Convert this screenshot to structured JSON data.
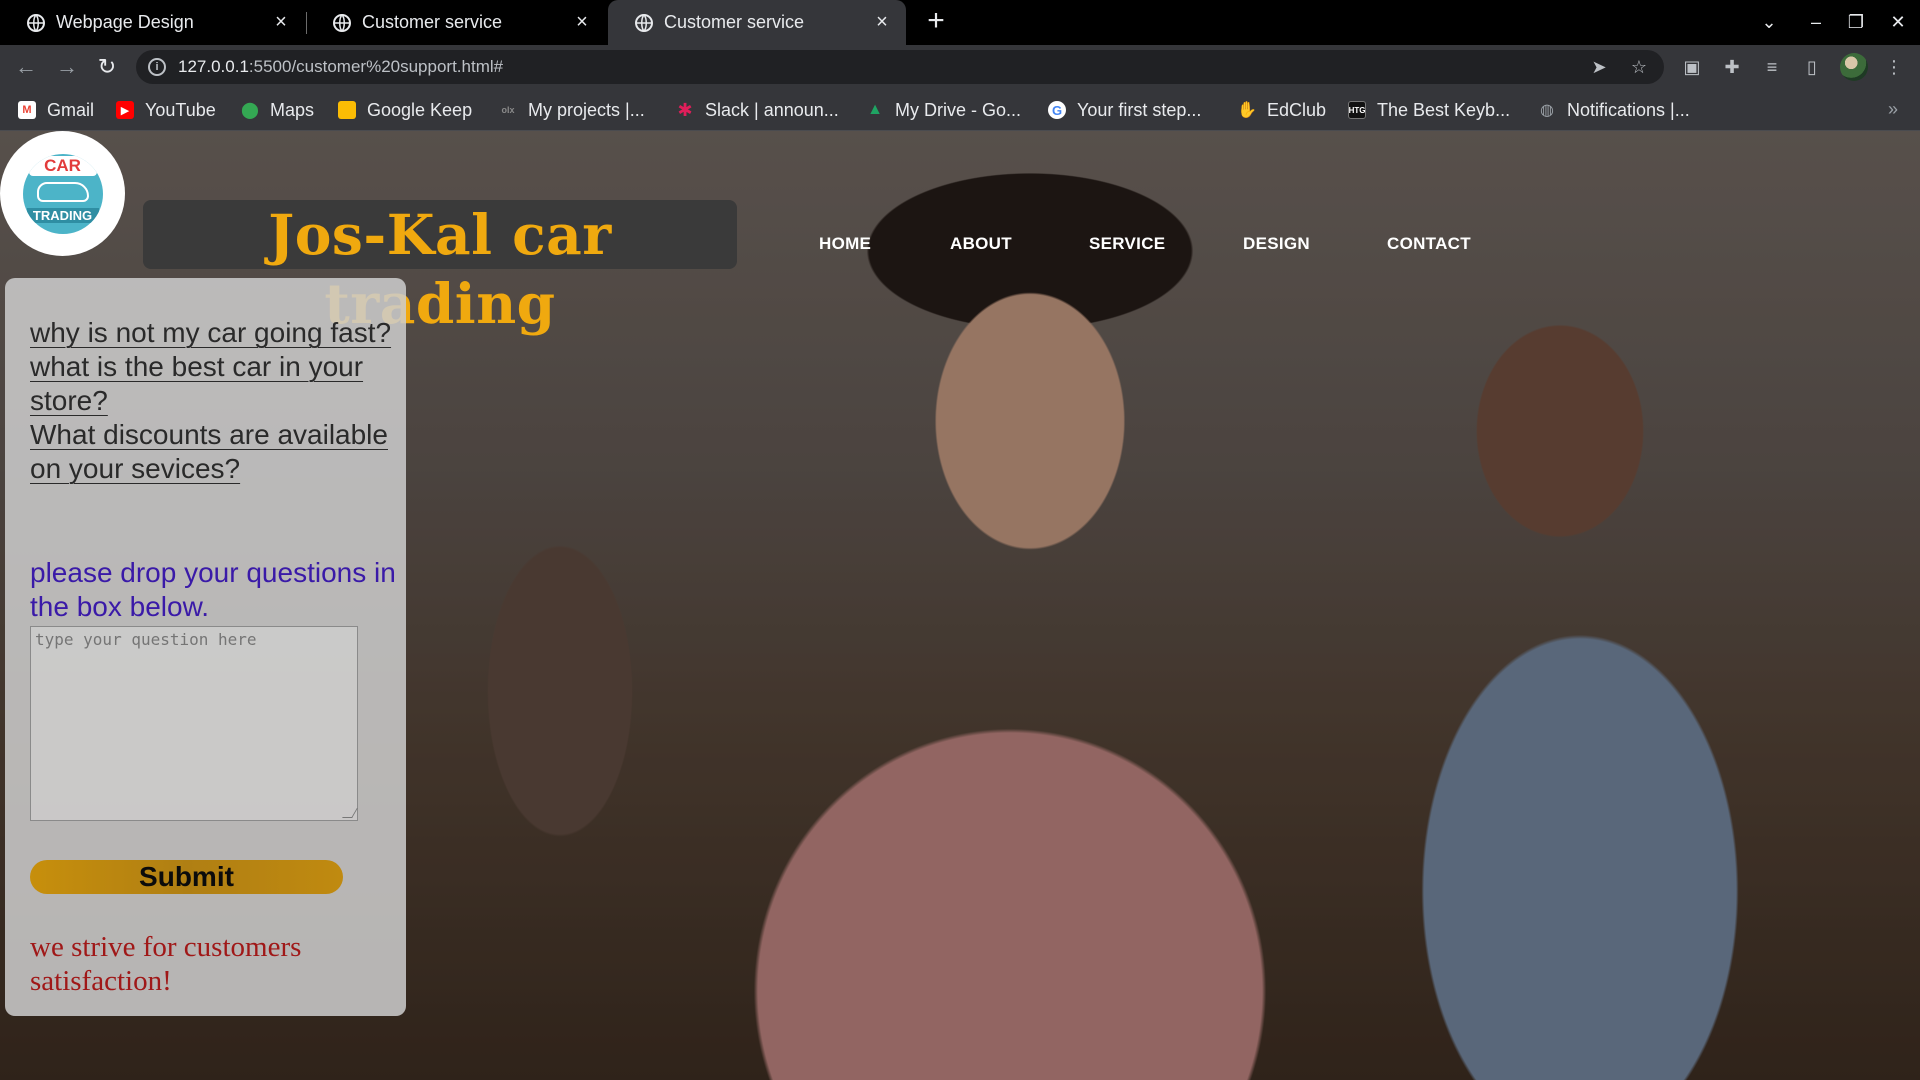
{
  "browser": {
    "tabs": [
      {
        "title": "Webpage Design",
        "active": false
      },
      {
        "title": "Customer service",
        "active": false
      },
      {
        "title": "Customer service",
        "active": true
      }
    ],
    "address": {
      "host": "127.0.0.1",
      "rest": ":5500/customer%20support.html#"
    },
    "bookmarks": [
      {
        "label": "Gmail",
        "icon": "gmail-icon",
        "color": "#ea4335"
      },
      {
        "label": "YouTube",
        "icon": "youtube-icon",
        "color": "#ff0000"
      },
      {
        "label": "Maps",
        "icon": "maps-pin-icon",
        "color": "#34a853"
      },
      {
        "label": "Google Keep",
        "icon": "keep-icon",
        "color": "#fbbc04"
      },
      {
        "label": "My projects |...",
        "icon": "olx-icon",
        "color": "#3a77ff"
      },
      {
        "label": "Slack | announ...",
        "icon": "slack-icon",
        "color": "#e01e5a"
      },
      {
        "label": "My Drive - Go...",
        "icon": "drive-icon",
        "color": "#1fa463"
      },
      {
        "label": "Your first step...",
        "icon": "google-icon",
        "color": "#4285f4"
      },
      {
        "label": "EdClub",
        "icon": "edclub-icon",
        "color": "#f5a623"
      },
      {
        "label": "The Best Keyb...",
        "icon": "htg-icon",
        "color": "#111111"
      },
      {
        "label": "Notifications |...",
        "icon": "globe-icon",
        "color": "#9aa0a6"
      }
    ]
  },
  "page": {
    "logo": {
      "top": "CAR",
      "bottom": "TRADING"
    },
    "brand": "Jos-Kal car trading",
    "nav": [
      "HOME",
      "ABOUT",
      "SERVICE",
      "DESIGN",
      "CONTACT"
    ],
    "faq": [
      "why is not my car going fast?",
      "what is the best car in your store?",
      "What discounts are available on your sevices?"
    ],
    "prompt": "please drop your questions in the box below.",
    "question_placeholder": "type your question here",
    "submit_label": "Submit",
    "tagline": "we strive for customers satisfaction!"
  },
  "colors": {
    "brand_text": "#f0a90f",
    "prompt_text": "#3a1aa8",
    "tagline_text": "#a01818",
    "submit_bg": "#b88712"
  }
}
